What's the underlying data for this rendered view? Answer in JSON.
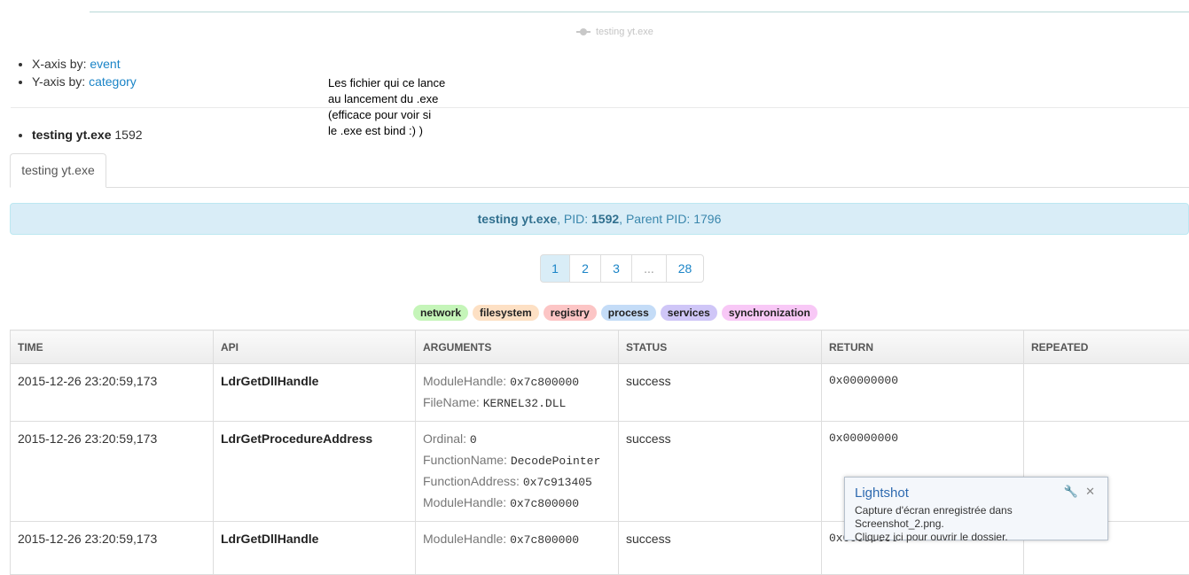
{
  "chart_legend": {
    "series_label": "testing yt.exe"
  },
  "axes": {
    "x_label": "X-axis by:",
    "x_value": "event",
    "y_label": "Y-axis by:",
    "y_value": "category"
  },
  "note_lines": [
    "Les fichier qui ce lance",
    "au lancement du .exe",
    "(efficace pour voir si",
    "le .exe est bind :) )"
  ],
  "process_list": {
    "name": "testing yt.exe",
    "pid": "1592"
  },
  "tab": {
    "label": "testing yt.exe"
  },
  "info": {
    "name": "testing yt.exe",
    "pid_label": ", PID: ",
    "pid": "1592",
    "parent_label": ", Parent PID: ",
    "parent_pid": "1796"
  },
  "pagination": [
    "1",
    "2",
    "3",
    "...",
    "28"
  ],
  "categories": [
    {
      "label": "network",
      "color": "#c5f5b9"
    },
    {
      "label": "filesystem",
      "color": "#fde0c4"
    },
    {
      "label": "registry",
      "color": "#fcc5c5"
    },
    {
      "label": "process",
      "color": "#c4dcf7"
    },
    {
      "label": "services",
      "color": "#cfc6f7"
    },
    {
      "label": "synchronization",
      "color": "#f8c8f6"
    }
  ],
  "table": {
    "headers": [
      "TIME",
      "API",
      "ARGUMENTS",
      "STATUS",
      "RETURN",
      "REPEATED"
    ],
    "rows": [
      {
        "time": "2015-12-26 23:20:59,173",
        "api": "LdrGetDllHandle",
        "args": [
          {
            "k": "ModuleHandle:",
            "v": "0x7c800000"
          },
          {
            "k": "FileName:",
            "v": "KERNEL32.DLL"
          }
        ],
        "status": "success",
        "ret": "0x00000000",
        "repeated": ""
      },
      {
        "time": "2015-12-26 23:20:59,173",
        "api": "LdrGetProcedureAddress",
        "args": [
          {
            "k": "Ordinal:",
            "v": "0"
          },
          {
            "k": "FunctionName:",
            "v": "DecodePointer"
          },
          {
            "k": "FunctionAddress:",
            "v": "0x7c913405"
          },
          {
            "k": "ModuleHandle:",
            "v": "0x7c800000"
          }
        ],
        "status": "success",
        "ret": "0x00000000",
        "repeated": ""
      },
      {
        "time": "2015-12-26 23:20:59,173",
        "api": "LdrGetDllHandle",
        "args": [
          {
            "k": "ModuleHandle:",
            "v": "0x7c800000"
          }
        ],
        "status": "success",
        "ret": "0x00000000",
        "repeated": ""
      }
    ]
  },
  "toast": {
    "title": "Lightshot",
    "line1": "Capture d'écran enregistrée dans Screenshot_2.png.",
    "line2": "Cliquez ici pour ouvrir le dossier."
  }
}
